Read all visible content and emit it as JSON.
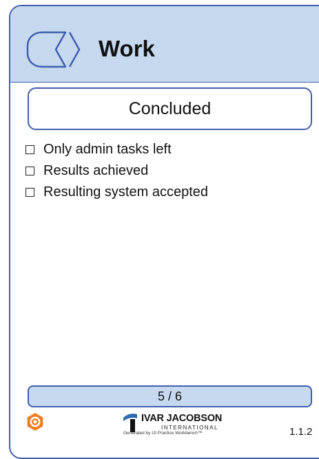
{
  "card": {
    "title": "Work",
    "icon": "alpha-work-icon",
    "state_name": "Concluded",
    "checklist": [
      "Only admin tasks left",
      "Results achieved",
      "Resulting system accepted"
    ],
    "page_indicator": "5 / 6",
    "version": "1.1.2"
  },
  "footer": {
    "logo_name": "IVAR JACOBSON",
    "logo_sub": "INTERNATIONAL",
    "generated_by": "Generated by IJI Practice Workbench™",
    "gear_icon": "gear-icon"
  },
  "colors": {
    "header_background": "#c6d9ef",
    "border": "#3f5fae",
    "gear": "#f07d1a",
    "logo_blue": "#2b6cb0"
  }
}
